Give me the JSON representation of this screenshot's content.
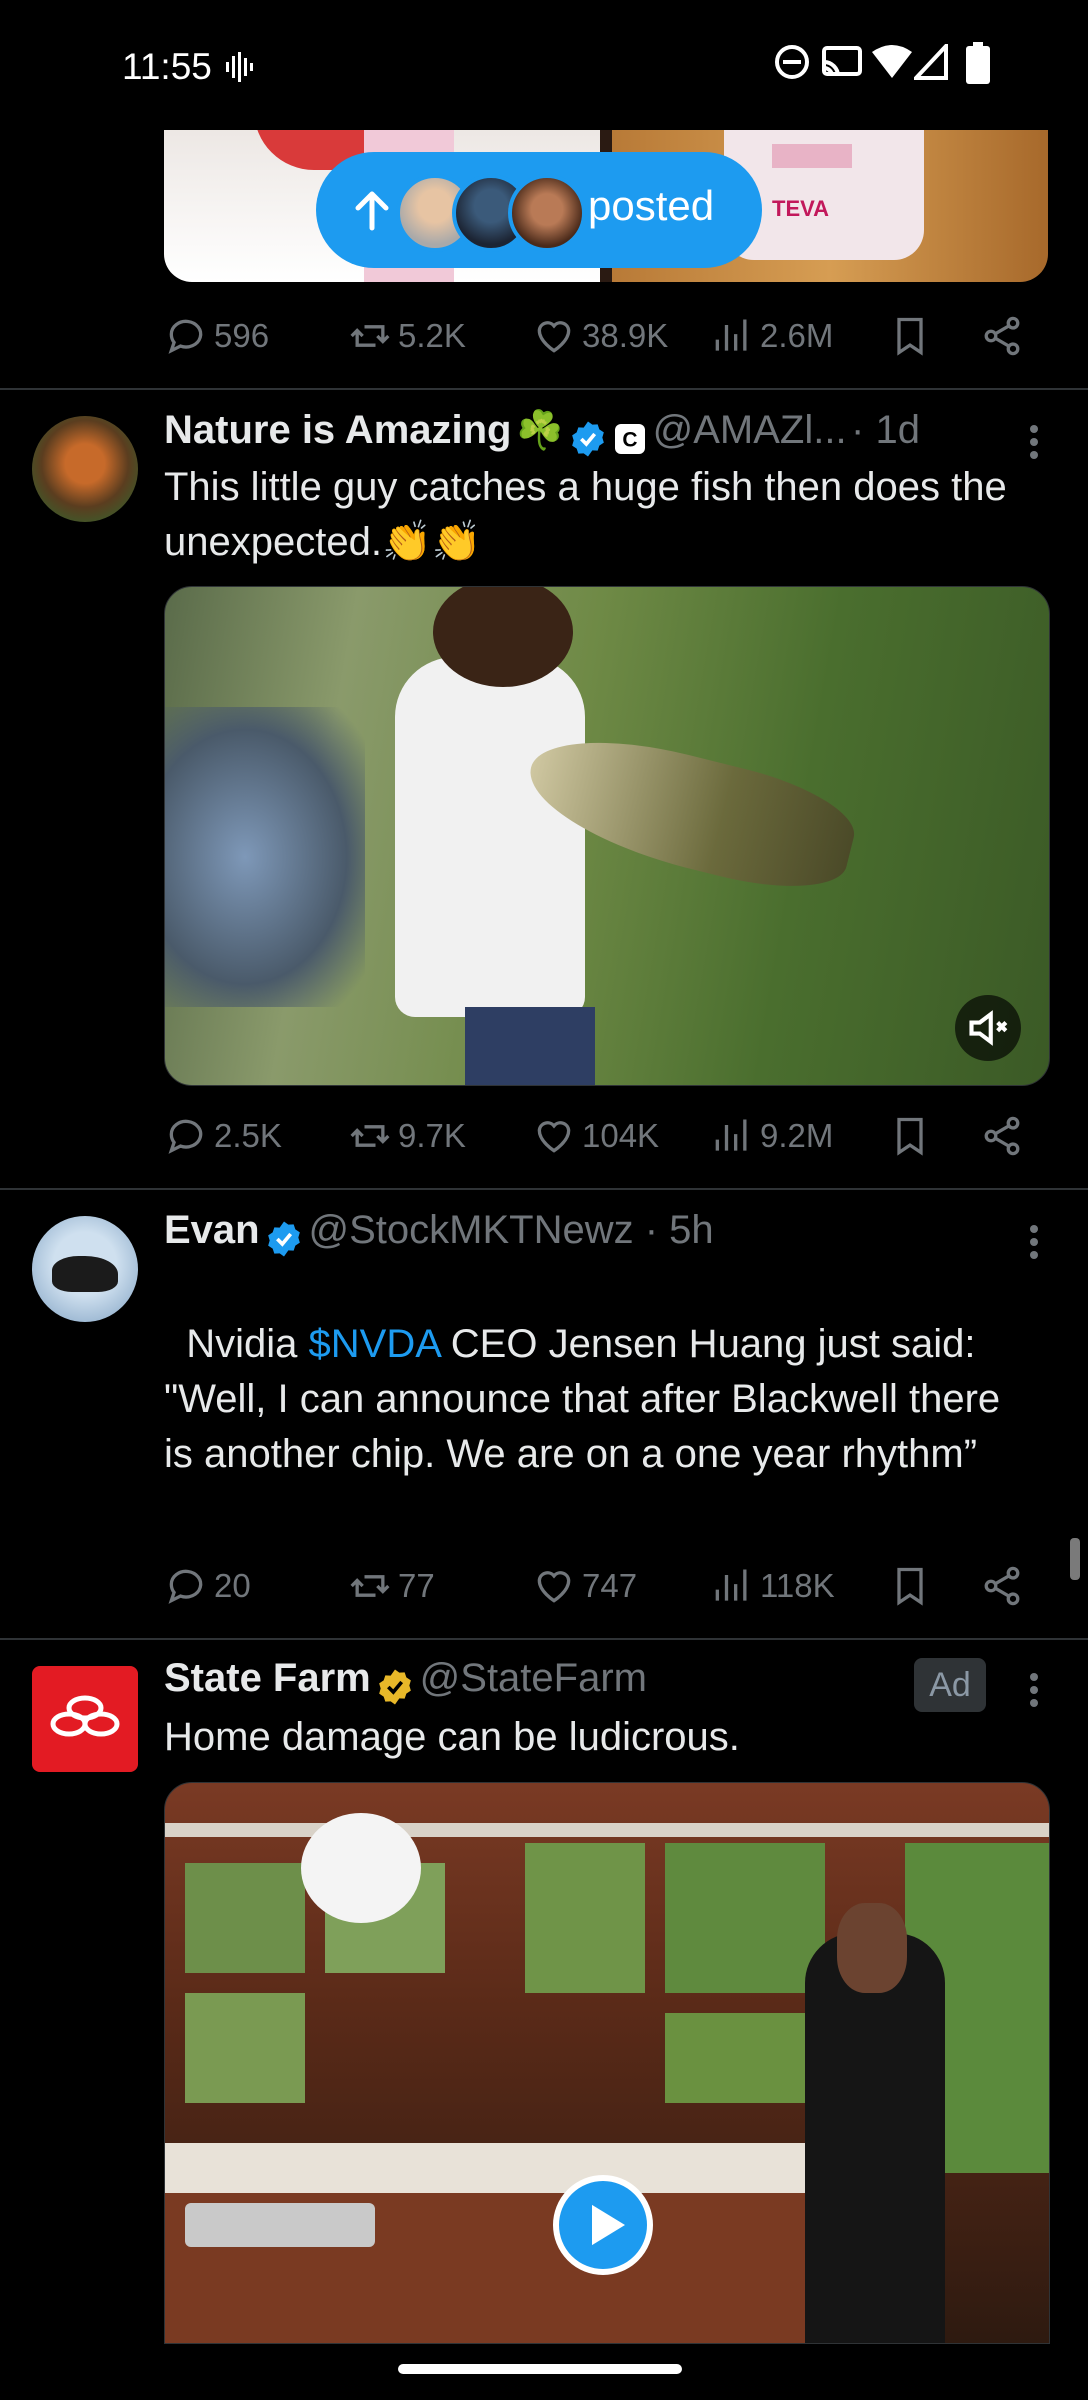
{
  "status_bar": {
    "time": "11:55"
  },
  "new_posts_pill": {
    "label": "posted"
  },
  "top_tweet_actions": {
    "replies": "596",
    "reposts": "5.2K",
    "likes": "38.9K",
    "views": "2.6M"
  },
  "tweet_nature": {
    "name": "Nature is Amazing",
    "name_emoji": "☘️",
    "handle": "@AMAZl...",
    "time": "· 1d",
    "text": "This little guy catches a huge fish then does the unexpected.👏👏",
    "actions": {
      "replies": "2.5K",
      "reposts": "9.7K",
      "likes": "104K",
      "views": "9.2M"
    }
  },
  "tweet_evan": {
    "name": "Evan",
    "handle": "@StockMKTNewz · 5h",
    "text_prefix": "Nvidia ",
    "cashtag": "$NVDA",
    "text_suffix": " CEO Jensen Huang just said:",
    "quote": "\"Well, I can announce that after Blackwell there is another chip. We are on a one year rhythm”",
    "actions": {
      "replies": "20",
      "reposts": "77",
      "likes": "747",
      "views": "118K"
    }
  },
  "tweet_statefarm": {
    "name": "State Farm",
    "handle": "@StateFarm",
    "ad_label": "Ad",
    "text": "Home damage can be ludicrous."
  },
  "icons": [
    "reply-icon",
    "repost-icon",
    "like-icon",
    "views-icon",
    "bookmark-icon",
    "share-icon",
    "more-icon",
    "mute-icon",
    "play-icon"
  ],
  "colors": {
    "accent": "#1d9bf0",
    "background": "#000000",
    "muted": "#71767b",
    "text": "#e7e9ea",
    "gold_verified": "#e8b829",
    "state_farm_red": "#e31b23"
  }
}
